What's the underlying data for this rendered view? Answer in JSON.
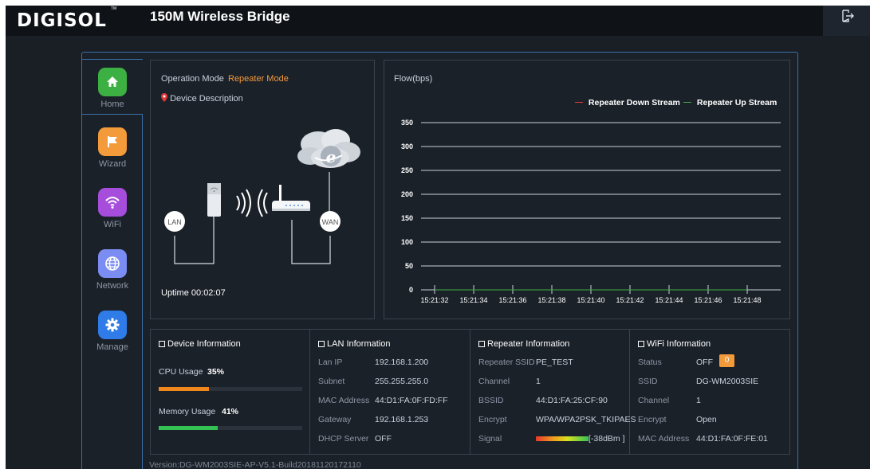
{
  "header": {
    "logo": "DIGISOL",
    "trademark": "TM",
    "title": "150M Wireless Bridge",
    "logout_icon": "logout-icon"
  },
  "nav": [
    {
      "label": "Home",
      "icon": "home-icon",
      "color": "#3cb043"
    },
    {
      "label": "Wizard",
      "icon": "flag-icon",
      "color": "#f39a3a"
    },
    {
      "label": "WiFi",
      "icon": "wifi-icon",
      "color": "#a64ddb"
    },
    {
      "label": "Network",
      "icon": "globe-icon",
      "color": "#7b8cf2"
    },
    {
      "label": "Manage",
      "icon": "gear-icon",
      "color": "#2f7ce8"
    }
  ],
  "operation": {
    "label": "Operation Mode",
    "value": "Repeater Mode",
    "device_description": "Device Description",
    "uptime": "Uptime 00:02:07",
    "diagram": {
      "lan": "LAN",
      "wan": "WAN",
      "cloud": "e"
    }
  },
  "flow": {
    "title": "Flow(bps)",
    "legend_down": "Repeater Down Stream",
    "legend_up": "Repeater Up Stream",
    "colors": {
      "down": "#e03a3a",
      "up": "#3cb043"
    }
  },
  "chart_data": {
    "type": "line",
    "title": "Flow(bps)",
    "x": [
      "15:21:32",
      "15:21:34",
      "15:21:36",
      "15:21:38",
      "15:21:40",
      "15:21:42",
      "15:21:44",
      "15:21:46",
      "15:21:48"
    ],
    "series": [
      {
        "name": "Repeater Down Stream",
        "values": [
          0,
          0,
          0,
          0,
          0,
          0,
          0,
          0,
          0
        ]
      },
      {
        "name": "Repeater Up Stream",
        "values": [
          0,
          0,
          0,
          0,
          0,
          0,
          0,
          0,
          0
        ]
      }
    ],
    "yticks": [
      0,
      50,
      100,
      150,
      200,
      250,
      300,
      350
    ],
    "ylim": [
      0,
      350
    ],
    "grid": true,
    "legend": "top-right"
  },
  "device_info": {
    "title": "Device Information",
    "cpu_label": "CPU Usage",
    "cpu_value": "35%",
    "cpu_fraction": 0.35,
    "cpu_color": "#f0871d",
    "mem_label": "Memory Usage",
    "mem_value": "41%",
    "mem_fraction": 0.41,
    "mem_color": "#35c255"
  },
  "lan_info": {
    "title": "LAN Information",
    "rows": [
      {
        "label": "Lan IP",
        "value": "192.168.1.200"
      },
      {
        "label": "Subnet",
        "value": "255.255.255.0"
      },
      {
        "label": "MAC Address",
        "value": "44:D1:FA:0F:FD:FF"
      },
      {
        "label": "Gateway",
        "value": "192.168.1.253"
      },
      {
        "label": "DHCP Server",
        "value": "OFF"
      }
    ]
  },
  "repeater_info": {
    "title": "Repeater Information",
    "rows": [
      {
        "label": "Repeater SSID",
        "value": "PE_TEST"
      },
      {
        "label": "Channel",
        "value": "1"
      },
      {
        "label": "BSSID",
        "value": "44:D1:FA:25:CF:90"
      },
      {
        "label": "Encrypt",
        "value": "WPA/WPA2PSK_TKIPAES"
      },
      {
        "label": "Signal",
        "value": "[-38dBm ]"
      }
    ]
  },
  "wifi_info": {
    "title": "WiFi Information",
    "rows": [
      {
        "label": "Status",
        "value": "OFF",
        "badge": "0"
      },
      {
        "label": "SSID",
        "value": "DG-WM2003SIE"
      },
      {
        "label": "Channel",
        "value": "1"
      },
      {
        "label": "Encrypt",
        "value": "Open"
      },
      {
        "label": "MAC Address",
        "value": "44:D1:FA:0F:FE:01"
      }
    ]
  },
  "footer": {
    "version": "Version:DG-WM2003SIE-AP-V5.1-Build20181120172110"
  }
}
